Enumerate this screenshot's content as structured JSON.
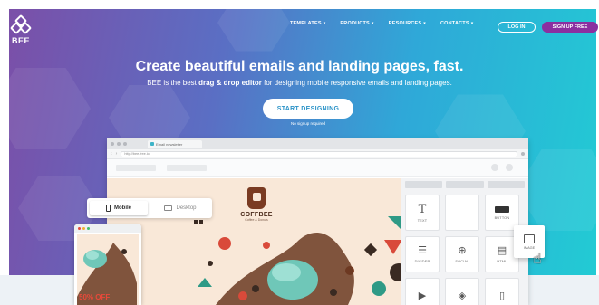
{
  "brand": {
    "name": "BEE"
  },
  "nav": {
    "items": [
      {
        "label": "TEMPLATES"
      },
      {
        "label": "PRODUCTS"
      },
      {
        "label": "RESOURCES"
      },
      {
        "label": "CONTACTS"
      }
    ],
    "login_label": "LOG IN",
    "signup_label": "SIGN UP FREE"
  },
  "hero": {
    "headline": "Create beautiful emails and landing pages, fast.",
    "sub_prefix": "BEE is the best ",
    "sub_bold": "drag & drop editor",
    "sub_suffix": " for designing mobile responsive emails and landing pages.",
    "cta_label": "START DESIGNING",
    "cta_note": "No signup required"
  },
  "editor": {
    "tab_title": "Email newsletter",
    "url": "http://bee.free.io",
    "brand_name": "COFFBEE",
    "brand_tagline": "Coffee & Donuts",
    "device_switch": {
      "mobile_label": "Mobile",
      "desktop_label": "Desktop"
    },
    "content_blocks": [
      {
        "label": "TEXT",
        "icon": "text-icon"
      },
      {
        "label": "",
        "icon": ""
      },
      {
        "label": "BUTTON",
        "icon": "button-icon"
      },
      {
        "label": "DIVIDER",
        "icon": "divider-icon"
      },
      {
        "label": "SOCIAL",
        "icon": "social-icon"
      },
      {
        "label": "HTML",
        "icon": "html-icon"
      },
      {
        "label": "",
        "icon": "video-icon"
      },
      {
        "label": "",
        "icon": "gif-icon"
      },
      {
        "label": "",
        "icon": "document-icon"
      }
    ],
    "dragging_block": {
      "label": "IMAGE",
      "icon": "image-icon"
    },
    "mobile_offer": "50% OFF"
  },
  "colors": {
    "gradient_start": "#7b4fa8",
    "gradient_end": "#22cbd4",
    "signup": "#8b2fa0",
    "cta_text": "#2b93c8",
    "coffee_brown": "#7a3b22",
    "offer_red": "#e8493a"
  }
}
